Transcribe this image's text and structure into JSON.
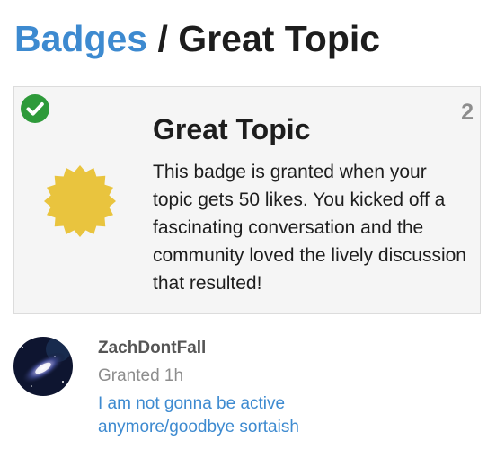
{
  "breadcrumb": {
    "parent_label": "Badges",
    "separator": " / ",
    "current_label": "Great Topic"
  },
  "badge": {
    "name": "Great Topic",
    "grant_count": "2",
    "earned": true,
    "icon": "gold-badge-icon",
    "description": "This badge is granted when your topic gets 50 likes. You kicked off a fascinating conversation and the community loved the lively discussion that resulted!"
  },
  "grants": [
    {
      "username": "ZachDontFall",
      "granted": "Granted 1h",
      "topic_link": "I am not gonna be active anymore/goodbye sortaish"
    }
  ],
  "colors": {
    "link": "#3d8ad0",
    "check": "#2e9a3a",
    "badge_gold": "#e9c43e"
  }
}
